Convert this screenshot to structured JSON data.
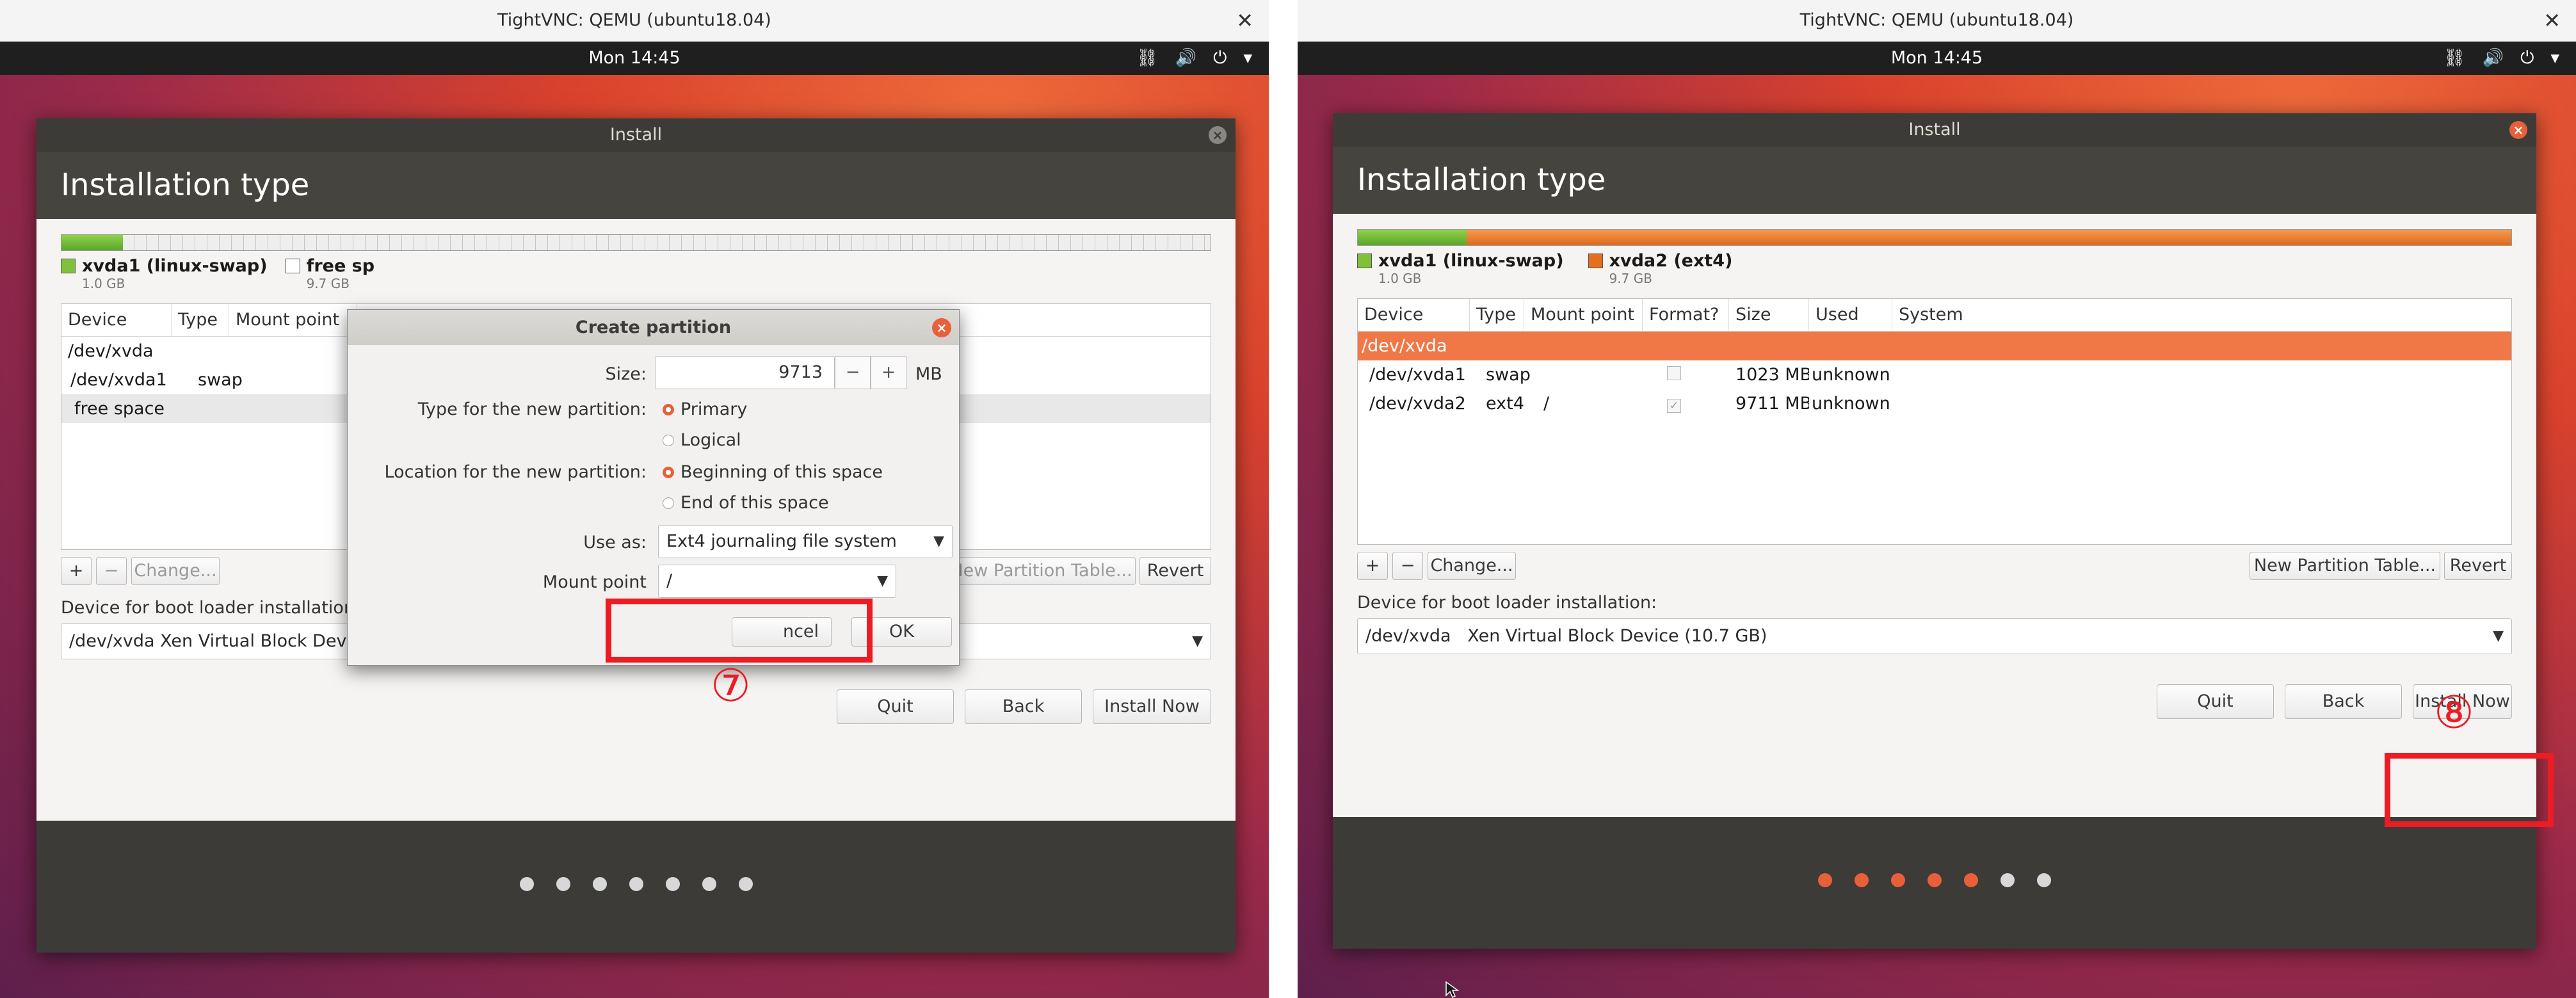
{
  "colors": {
    "ubuntu_orange": "#e8603a",
    "header_dark": "#45443f",
    "annotation_red": "#ec1c24",
    "swap_green": "#7fc13a",
    "ext4_orange": "#e3701f"
  },
  "vnc_title": "TightVNC: QEMU (ubuntu18.04)",
  "clock": "Mon 14:45",
  "tray_icons": [
    "network-icon",
    "volume-icon",
    "power-icon",
    "chevron-down-icon"
  ],
  "window": {
    "title": "Install",
    "heading": "Installation type"
  },
  "columns": [
    "Device",
    "Type",
    "Mount point",
    "Format?",
    "Size",
    "Used",
    "System"
  ],
  "left": {
    "legend": [
      {
        "name": "xvda1 (linux-swap)",
        "size": "1.0 GB"
      },
      {
        "name": "free sp",
        "size": "9.7 GB"
      }
    ],
    "rows": [
      {
        "device": "/dev/xvda"
      },
      {
        "device": "/dev/xvda1",
        "type": "swap"
      },
      {
        "device": "free space"
      }
    ],
    "change_button": "Change...",
    "new_partition_table_button": "New Partition Table...",
    "revert_button": "Revert",
    "boot_loader_label": "Device for boot loader installation",
    "boot_loader_value": "/dev/xvda Xen Virtual Block Device (10.7 GB)",
    "buttons": {
      "quit": "Quit",
      "back": "Back",
      "install_now": "Install Now"
    },
    "progress": {
      "total": 7,
      "done": 0
    },
    "dialog": {
      "title": "Create partition",
      "size_label": "Size:",
      "size_value": "9713",
      "size_unit": "MB",
      "type_label": "Type for the new partition:",
      "type_options": [
        "Primary",
        "Logical"
      ],
      "type_selected": "Primary",
      "location_label": "Location for the new partition:",
      "location_options": [
        "Beginning of this space",
        "End of this space"
      ],
      "location_selected": "Beginning of this space",
      "use_as_label": "Use as:",
      "use_as_value": "Ext4 journaling file system",
      "mount_label": "Mount point",
      "mount_value": "/",
      "cancel_visible": "ncel",
      "ok": "OK"
    },
    "annotation": "⑦"
  },
  "right": {
    "legend": [
      {
        "name": "xvda1 (linux-swap)",
        "size": "1.0 GB"
      },
      {
        "name": "xvda2 (ext4)",
        "size": "9.7 GB"
      }
    ],
    "rows": [
      {
        "device": "/dev/xvda",
        "type": "",
        "mount": "",
        "format": "",
        "size": "",
        "used": "",
        "system": ""
      },
      {
        "device": "/dev/xvda1",
        "type": "swap",
        "mount": "",
        "format": "unchecked",
        "size": "1023 MB",
        "used": "unknown",
        "system": ""
      },
      {
        "device": "/dev/xvda2",
        "type": "ext4",
        "mount": "/",
        "format": "checked",
        "size": "9711 MB",
        "used": "unknown",
        "system": ""
      }
    ],
    "change_button": "Change...",
    "new_partition_table_button": "New Partition Table...",
    "revert_button": "Revert",
    "boot_loader_label": "Device for boot loader installation:",
    "boot_loader_value": "/dev/xvda   Xen Virtual Block Device (10.7 GB)",
    "buttons": {
      "quit": "Quit",
      "back": "Back",
      "install_now": "Install Now"
    },
    "progress": {
      "total": 7,
      "done": 5
    },
    "annotation": "⑧"
  }
}
